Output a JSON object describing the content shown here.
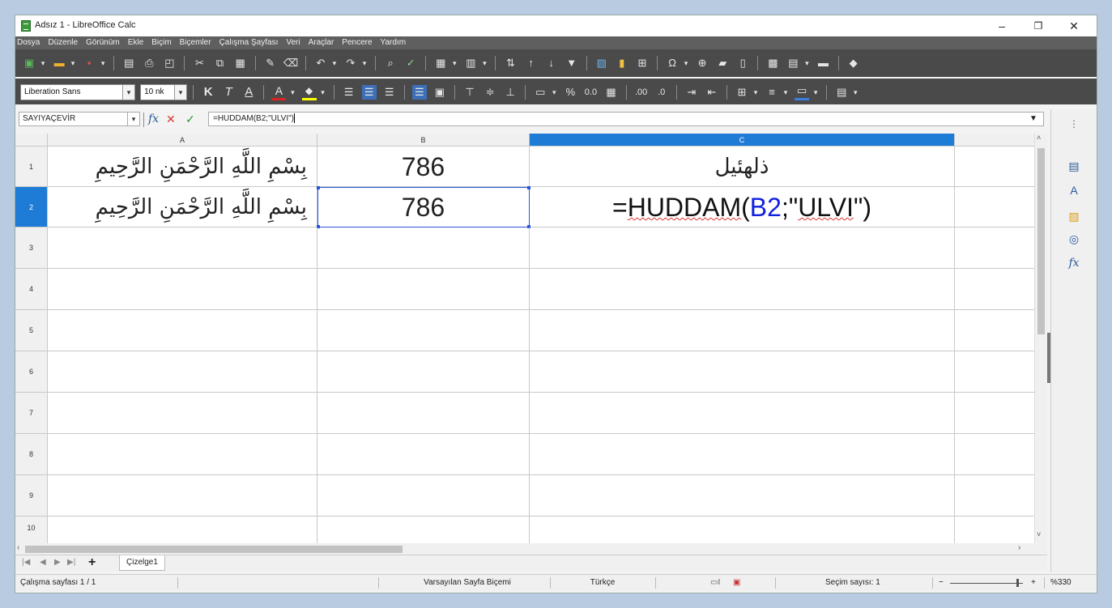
{
  "window": {
    "title": "Adsız 1 - LibreOffice Calc",
    "controls": {
      "minimize": "–",
      "restore": "❐",
      "close": "✕"
    }
  },
  "menu": [
    "Dosya",
    "Düzenle",
    "Görünüm",
    "Ekle",
    "Biçim",
    "Biçemler",
    "Çalışma Şayfası",
    "Veri",
    "Araçlar",
    "Pencere",
    "Yardım"
  ],
  "format_toolbar": {
    "font_name": "Liberation Sans",
    "font_size": "10 nk",
    "zoom_readout": "%330"
  },
  "formula_bar": {
    "name_box": "SAYIYAÇEVİR",
    "formula": "=HUDDAM(B2;\"ULVI\")"
  },
  "columns": [
    "A",
    "B",
    "C"
  ],
  "selected_column": "C",
  "rows": [
    "1",
    "2",
    "3",
    "4",
    "5",
    "6",
    "7",
    "8",
    "9",
    "10"
  ],
  "selected_row": "2",
  "cells": {
    "A1": "بِسْمِ اللَّهِ الرَّحْمَنِ الرَّحِيمِ",
    "B1": "786",
    "C1": "ذلهئيل",
    "A2": "بِسْمِ اللَّهِ الرَّحْمَنِ الرَّحِيمِ",
    "B2": "786",
    "C2_prefix": "=",
    "C2_fn": "HUDDAM",
    "C2_open": "(",
    "C2_ref": "B2",
    "C2_sep": ";\"",
    "C2_arg": "ULVI",
    "C2_close": "\")"
  },
  "sheet_tab": "Çizelge1",
  "status": {
    "sheet": "Çalışma sayfası 1 / 1",
    "page_style": "Varsayılan Sayfa Biçemi",
    "language": "Türkçe",
    "selection": "Seçim sayısı: 1",
    "zoom": "%330"
  },
  "colors": {
    "selection": "#1e7bd6",
    "toolbar": "#4a4a4a",
    "menubar": "#5f5f5f"
  }
}
